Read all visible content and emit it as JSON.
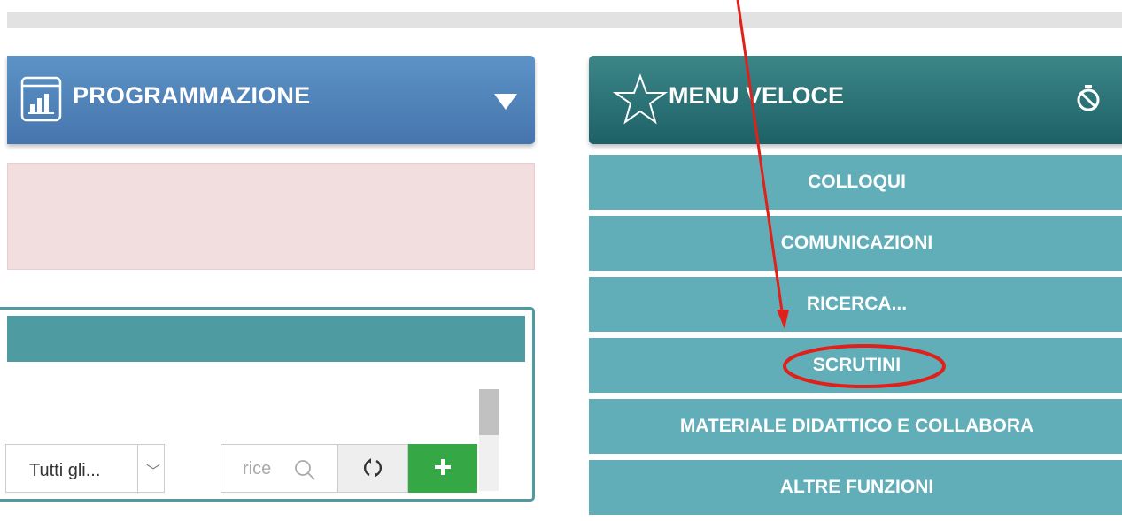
{
  "programmazione": {
    "title": "PROGRAMMAZIONE"
  },
  "toolbar": {
    "filter_value": "Tutti gli...",
    "search_placeholder": "rice",
    "add_label": "+"
  },
  "menu_veloce": {
    "title": "MENU VELOCE",
    "items": [
      {
        "label": "COLLOQUI"
      },
      {
        "label": "COMUNICAZIONI"
      },
      {
        "label": "RICERCA..."
      },
      {
        "label": "SCRUTINI"
      },
      {
        "label": "MATERIALE DIDATTICO E COLLABORA"
      },
      {
        "label": "ALTRE FUNZIONI"
      }
    ]
  },
  "icons": {
    "programmazione": "chart-icon",
    "toggle": "chevron-down-icon",
    "menu": "star-icon",
    "timer": "timer-off-icon",
    "search": "search-icon",
    "refresh": "refresh-icon",
    "add": "plus-icon"
  },
  "colors": {
    "programmazione_header": "#4675ad",
    "menu_header": "#1d6166",
    "menu_item": "#62aeb8",
    "alert_bg": "#f2dedf",
    "add_button": "#35a845",
    "annotation": "#e0201b"
  }
}
